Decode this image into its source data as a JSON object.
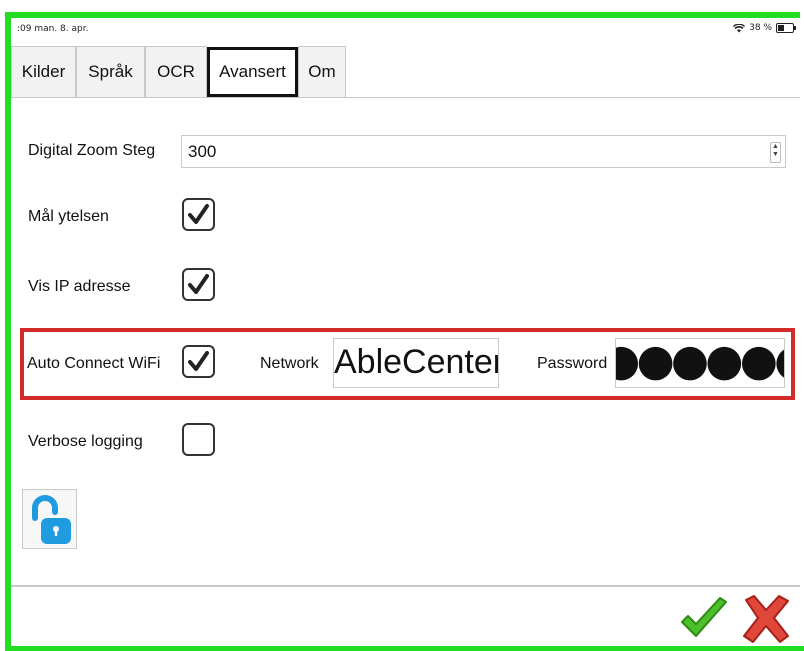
{
  "status_bar": {
    "time_date": ":09  man. 8. apr.",
    "battery_text": "38 %"
  },
  "tabs": [
    {
      "label": "Kilder",
      "active": false
    },
    {
      "label": "Språk",
      "active": false
    },
    {
      "label": "OCR",
      "active": false
    },
    {
      "label": "Avansert",
      "active": true
    },
    {
      "label": "Om",
      "active": false
    }
  ],
  "settings": {
    "digital_zoom": {
      "label": "Digital Zoom Steg",
      "value": "300"
    },
    "measure_performance": {
      "label": "Mål ytelsen",
      "checked": true
    },
    "show_ip": {
      "label": "Vis IP adresse",
      "checked": true
    },
    "auto_connect": {
      "label": "Auto Connect WiFi",
      "checked": true,
      "network_label": "Network",
      "network_value": "AbleCenter",
      "password_label": "Password",
      "password_value": "●●●●●●●"
    },
    "verbose_logging": {
      "label": "Verbose logging",
      "checked": false
    }
  },
  "colors": {
    "highlight_border": "#d32a2a",
    "frame_green": "#22dd22",
    "lock_blue": "#1f9be0"
  },
  "icons": {
    "lock": "unlocked-padlock-icon",
    "confirm": "green-checkmark-icon",
    "cancel": "red-x-icon"
  }
}
